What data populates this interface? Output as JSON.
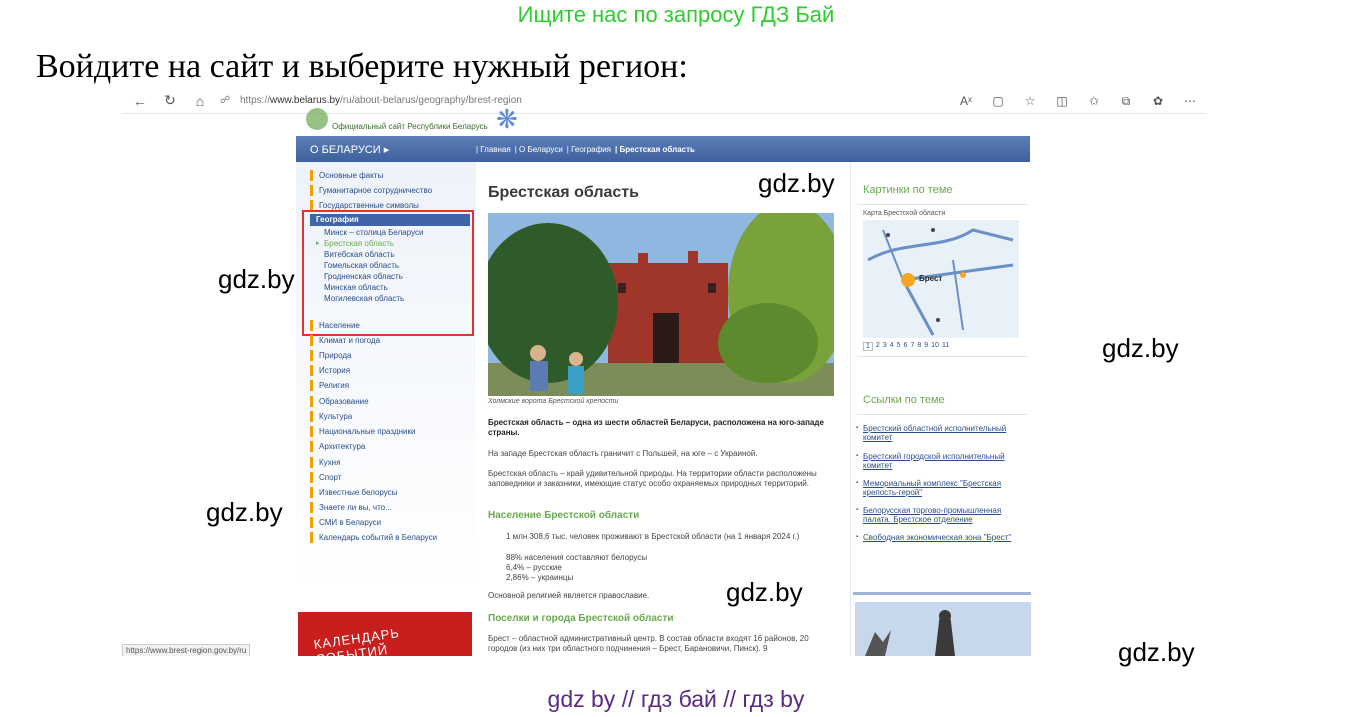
{
  "banner_top": "Ищите нас по запросу ГДЗ Бай",
  "heading": "Войдите на сайт и выберите нужный регион:",
  "browser": {
    "url_prefix": "https://",
    "url_host": "www.belarus.by",
    "url_path": "/ru/about-belarus/geography/brest-region",
    "status_url": "https://www.brest-region.gov.by/ru"
  },
  "site": {
    "logo_caption": "Официальный сайт Республики Беларусь",
    "nav_title": "О БЕЛАРУСИ ▸",
    "breadcrumb": [
      "| Главная",
      "| О Беларуси",
      "| География",
      "| Брестская область"
    ],
    "sidebar_items": [
      "Основные факты",
      "Гуманитарное сотрудничество",
      "Государственные символы"
    ],
    "geo_header": "География",
    "geo_subitems": [
      "Минск – столица Беларуси",
      "Брестская область",
      "Витебская область",
      "Гомельская область",
      "Гродненская область",
      "Минская область",
      "Могилевская область"
    ],
    "sidebar_items_after": [
      "Население",
      "Климат и погода",
      "Природа",
      "История",
      "Религия",
      "Образование",
      "Культура",
      "Национальные праздники",
      "Архитектура",
      "Кухня",
      "Спорт",
      "Известные белорусы",
      "Знаете ли вы, что...",
      "СМИ в Беларуси",
      "Календарь событий в Беларуси"
    ],
    "red_card": "КАЛЕНДАРЬ СОБЫТИЙ",
    "article": {
      "title": "Брестская область",
      "photo_caption": "Холмские ворота Брестской крепости",
      "lead": "Брестская область – одна из шести областей Беларуси, расположена на юго-западе страны.",
      "p1": "На западе Брестская область граничит с Польшей, на юге – с Украиной.",
      "p2": "Брестская область – край удивительной природы. На территории области расположены заповедники и заказники, имеющие статус особо охраняемых природных территорий.",
      "section1": "Население Брестской области",
      "bullets": [
        "1 млн 308,6 тыс. человек проживают в Брестской области (на 1 января 2024 г.)",
        "88% населения составляют белорусы",
        "6,4% – русские",
        "2,86% – украинцы"
      ],
      "p3": "Основной религией является православие.",
      "section2": "Поселки и города Брестской области",
      "p4": "Брест – областной административный центр. В состав области входят 16 районов, 20 городов (из них три областного подчинения – Брест, Барановичи, Пинск). 9"
    },
    "right": {
      "pictures_title": "Картинки по теме",
      "map_caption": "Карта Брестской области",
      "map_city": "Брест",
      "pager": [
        "1",
        "2",
        "3",
        "4",
        "5",
        "6",
        "7",
        "8",
        "9",
        "10",
        "11"
      ],
      "links_title": "Ссылки по теме",
      "links": [
        "Брестский областной исполнительный комитет",
        "Брестский городской исполнительный комитет",
        "Мемориальный комплекс \"Брестская крепость-герой\"",
        "Белорусская торгово-промышленная палата. Брестское отделение",
        "Свободная экономическая зона \"Брест\""
      ]
    }
  },
  "watermark": "gdz.by",
  "banner_bottom": "gdz by  //  гдз бай  //  гдз by",
  "colors": {
    "banner_green": "#2ecc2e",
    "banner_purple": "#5a2a84",
    "site_blue": "#3e619e",
    "site_green": "#6aa84f",
    "highlight_red": "#d33333"
  }
}
